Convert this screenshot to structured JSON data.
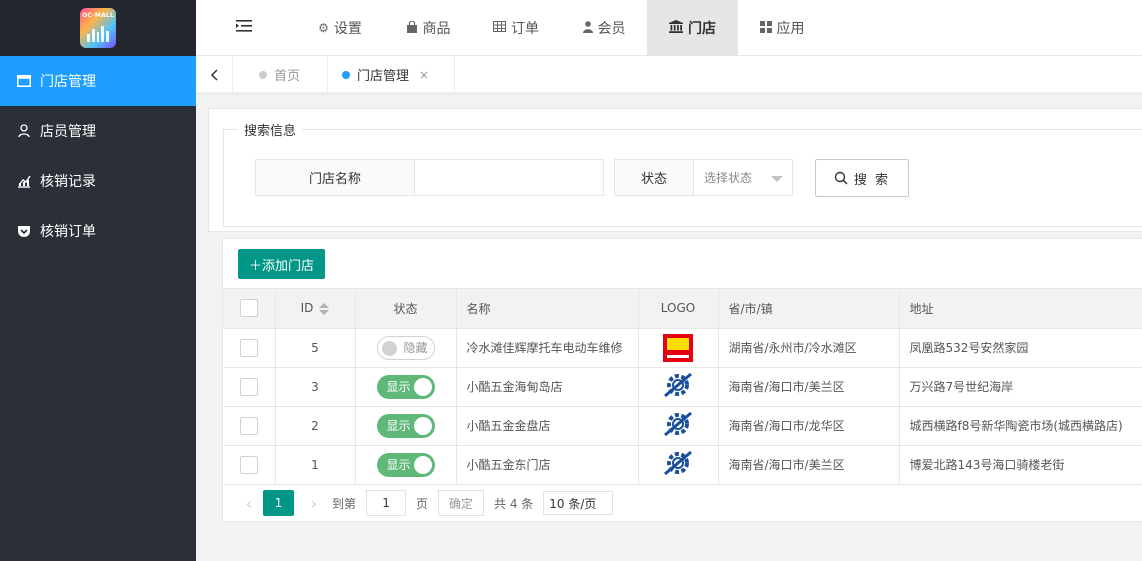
{
  "brand": {
    "logo_text": "OC-MALL"
  },
  "sidebar": {
    "items": [
      {
        "label": "门店管理",
        "icon": "window-icon",
        "active": true
      },
      {
        "label": "店员管理",
        "icon": "user-icon",
        "active": false
      },
      {
        "label": "核销记录",
        "icon": "chart-icon",
        "active": false
      },
      {
        "label": "核销订单",
        "icon": "pocket-icon",
        "active": false
      }
    ]
  },
  "topnav": {
    "items": [
      {
        "label": "设置",
        "icon": "gears-icon"
      },
      {
        "label": "商品",
        "icon": "shopping-bag-icon"
      },
      {
        "label": "订单",
        "icon": "table-icon"
      },
      {
        "label": "会员",
        "icon": "user-icon"
      },
      {
        "label": "门店",
        "icon": "bank-icon",
        "active": true
      },
      {
        "label": "应用",
        "icon": "grid-icon"
      }
    ]
  },
  "tabs": [
    {
      "label": "首页",
      "active": false
    },
    {
      "label": "门店管理",
      "active": true,
      "close": "×"
    }
  ],
  "search": {
    "legend": "搜索信息",
    "name_label": "门店名称",
    "name_value": "",
    "status_label": "状态",
    "status_placeholder": "选择状态",
    "button": "搜 索"
  },
  "toolbar": {
    "add_label": "＋添加门店"
  },
  "table": {
    "headers": {
      "id": "ID",
      "status": "状态",
      "name": "名称",
      "logo": "LOGO",
      "region": "省/市/镇",
      "address": "地址"
    },
    "rows": [
      {
        "id": "5",
        "status": "隐藏",
        "status_on": false,
        "name": "冷水滩佳辉摩托车电动车维修",
        "logo": "red-brand-logo",
        "region": "湖南省/永州市/冷水滩区",
        "address": "凤凰路532号安然家园"
      },
      {
        "id": "3",
        "status": "显示",
        "status_on": true,
        "name": "小酷五金海甸岛店",
        "logo": "gear-logo",
        "region": "海南省/海口市/美兰区",
        "address": "万兴路7号世纪海岸"
      },
      {
        "id": "2",
        "status": "显示",
        "status_on": true,
        "name": "小酷五金金盘店",
        "logo": "gear-logo",
        "region": "海南省/海口市/龙华区",
        "address": "城西横路f8号新华陶瓷市场(城西横路店)"
      },
      {
        "id": "1",
        "status": "显示",
        "status_on": true,
        "name": "小酷五金东门店",
        "logo": "gear-logo",
        "region": "海南省/海口市/美兰区",
        "address": "博爱北路143号海口骑楼老街"
      }
    ]
  },
  "pager": {
    "current": "1",
    "goto_label": "到第",
    "goto_value": "1",
    "page_unit": "页",
    "confirm": "确定",
    "total": "共 4 条",
    "page_size": "10 条/页"
  },
  "colors": {
    "accent": "#1e9fff",
    "primary": "#009688",
    "switch_on": "#5fb878",
    "sidebar_bg": "#2a2f38"
  }
}
